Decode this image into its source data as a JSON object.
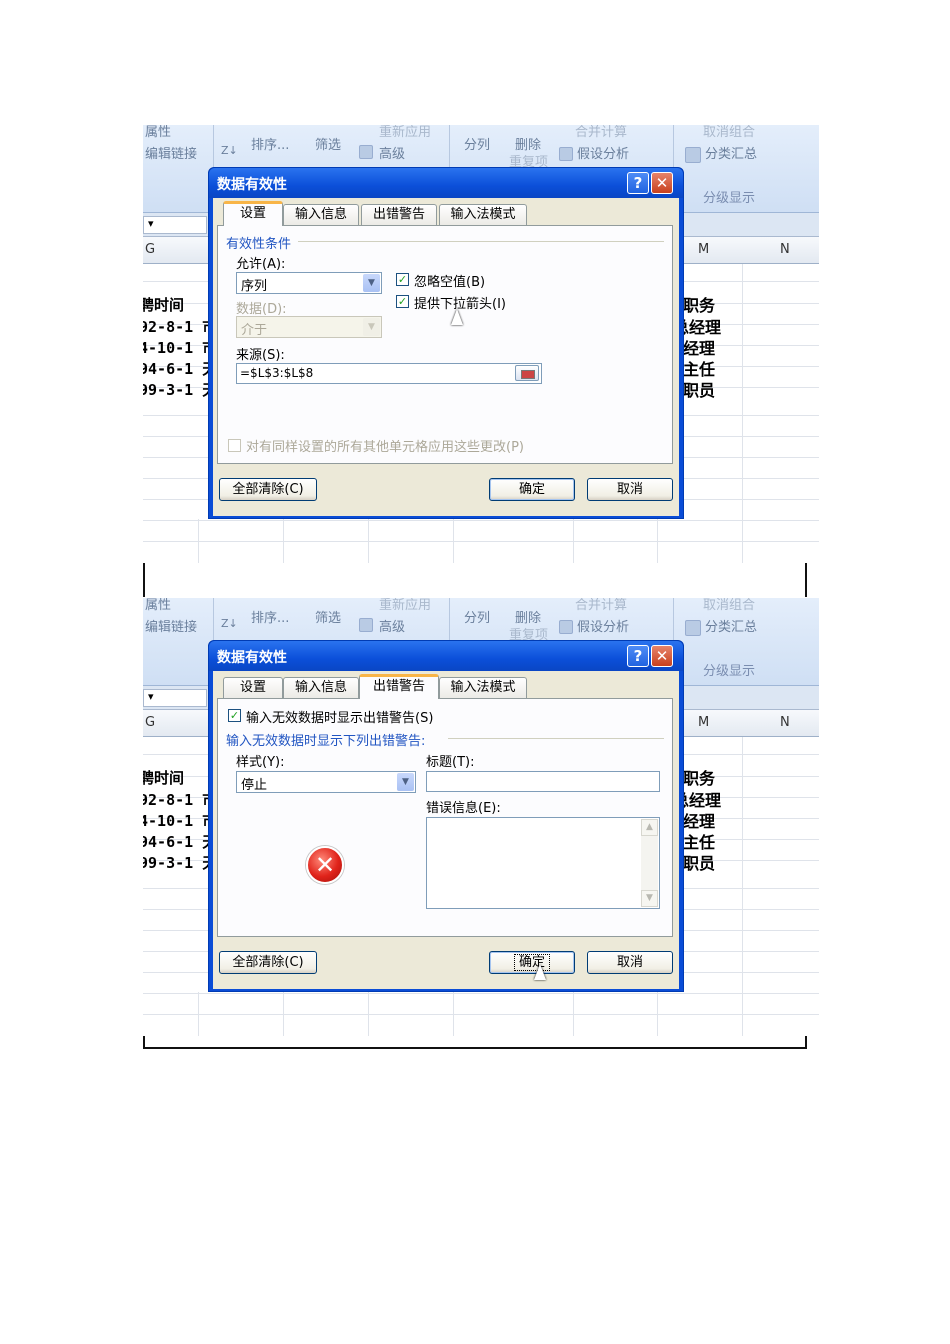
{
  "panel1": {
    "ribbon": {
      "items": [
        "属性",
        "编辑链接",
        "排序...",
        "筛选",
        "重新应用",
        "高级",
        "分列",
        "删除",
        "重复项",
        "合并计算",
        "假设分析",
        "取消组合",
        "分类汇总",
        "分级显示"
      ],
      "sort_icon": "sort-az-icon"
    },
    "name_box": "▾",
    "columns": {
      "g": "G",
      "m": "M",
      "n": "N"
    },
    "left_cells": [
      "聘时间",
      "92-8-1 市",
      "4-10-1 市",
      "94-6-1 天",
      "99-3-1 天"
    ],
    "right_cells": [
      "职务",
      "总经理",
      "经理",
      "主任",
      "职员"
    ],
    "dialog": {
      "title": "数据有效性",
      "help": "?",
      "close": "✕",
      "tabs": [
        "设置",
        "输入信息",
        "出错警告",
        "输入法模式"
      ],
      "active_tab": 0,
      "section_label": "有效性条件",
      "allow_label": "允许(A):",
      "allow_value": "序列",
      "data_label": "数据(D):",
      "data_value": "介于",
      "ignore_blank": "忽略空值(B)",
      "dropdown_arrow": "提供下拉箭头(I)",
      "source_label": "来源(S):",
      "source_value": "=$L$3:$L$8",
      "apply_all": "对有同样设置的所有其他单元格应用这些更改(P)",
      "clear_all": "全部清除(C)",
      "ok": "确定",
      "cancel": "取消"
    }
  },
  "panel2": {
    "ribbon": {
      "items": [
        "属性",
        "编辑链接",
        "排序...",
        "筛选",
        "重新应用",
        "高级",
        "分列",
        "删除",
        "重复项",
        "合并计算",
        "假设分析",
        "取消组合",
        "分类汇总",
        "分级显示"
      ]
    },
    "name_box": "▾",
    "columns": {
      "g": "G",
      "m": "M",
      "n": "N"
    },
    "left_cells": [
      "聘时间",
      "92-8-1 市",
      "4-10-1 市",
      "94-6-1 天",
      "99-3-1 天"
    ],
    "right_cells": [
      "职务",
      "总经理",
      "经理",
      "主任",
      "职员"
    ],
    "dialog": {
      "title": "数据有效性",
      "help": "?",
      "close": "✕",
      "tabs": [
        "设置",
        "输入信息",
        "出错警告",
        "输入法模式"
      ],
      "active_tab": 2,
      "show_error": "输入无效数据时显示出错警告(S)",
      "section_label": "输入无效数据时显示下列出错警告:",
      "style_label": "样式(Y):",
      "style_value": "停止",
      "title_label": "标题(T):",
      "title_value": "",
      "error_msg_label": "错误信息(E):",
      "error_msg_value": "",
      "error_icon": "stop-error-icon",
      "clear_all": "全部清除(C)",
      "ok": "确定",
      "cancel": "取消"
    }
  }
}
